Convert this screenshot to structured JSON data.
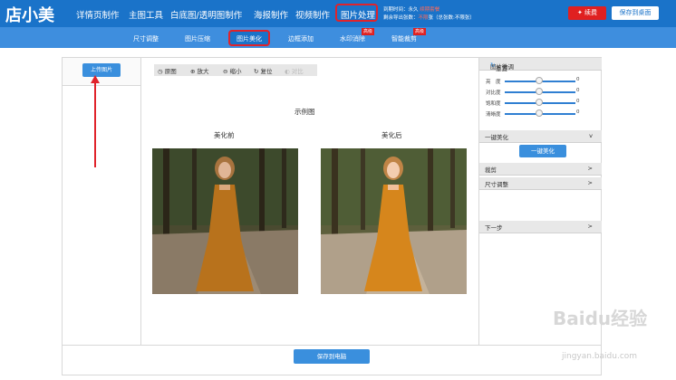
{
  "header": {
    "logo": "店小美",
    "nav": [
      "详情页制作",
      "主图工具",
      "白底图/透明图制作",
      "海报制作",
      "视频制作"
    ],
    "nav_active": "图片处理",
    "info_line1_prefix": "到期时间：永久",
    "info_line1_red": "续期套餐",
    "info_line2_prefix": "剩余导出张数：",
    "info_line2_red": "不限",
    "info_line2_suffix": "张（总张数:不限张）",
    "btn_renew": "续费",
    "btn_save_desktop": "保存到桌面"
  },
  "subnav": {
    "items": [
      "尺寸调整",
      "图片压缩",
      "边框添加",
      "水印消除",
      "智能裁剪"
    ],
    "active": "图片美化",
    "badges": [
      "高级",
      "高级"
    ]
  },
  "left": {
    "upload": "上传图片"
  },
  "toolbar": {
    "tools": [
      "原图",
      "放大",
      "缩小",
      "复位",
      "对比"
    ]
  },
  "canvas": {
    "sample_title": "示例图",
    "before": "美化前",
    "after": "美化后"
  },
  "right": {
    "fine_tune": "图片微调",
    "reset": "重置",
    "sliders": [
      {
        "label": "亮　度",
        "value": "0"
      },
      {
        "label": "对比度",
        "value": "0"
      },
      {
        "label": "饱和度",
        "value": "0"
      },
      {
        "label": "清晰度",
        "value": "0"
      }
    ],
    "oneclick_section": "一键美化",
    "oneclick_btn": "一键美化",
    "crop": "裁剪",
    "resize": "尺寸调整",
    "next": "下一步",
    "chev_down": "v",
    "chev_right": ">"
  },
  "bottom": {
    "save_pc": "保存到电脑"
  },
  "watermark": {
    "main": "Baidu经验",
    "sub": "jingyan.baidu.com"
  },
  "colors": {
    "topbar": "#1a73c9",
    "subbar": "#3e8ede",
    "highlight": "#e0232b",
    "button": "#3a8fdd"
  }
}
